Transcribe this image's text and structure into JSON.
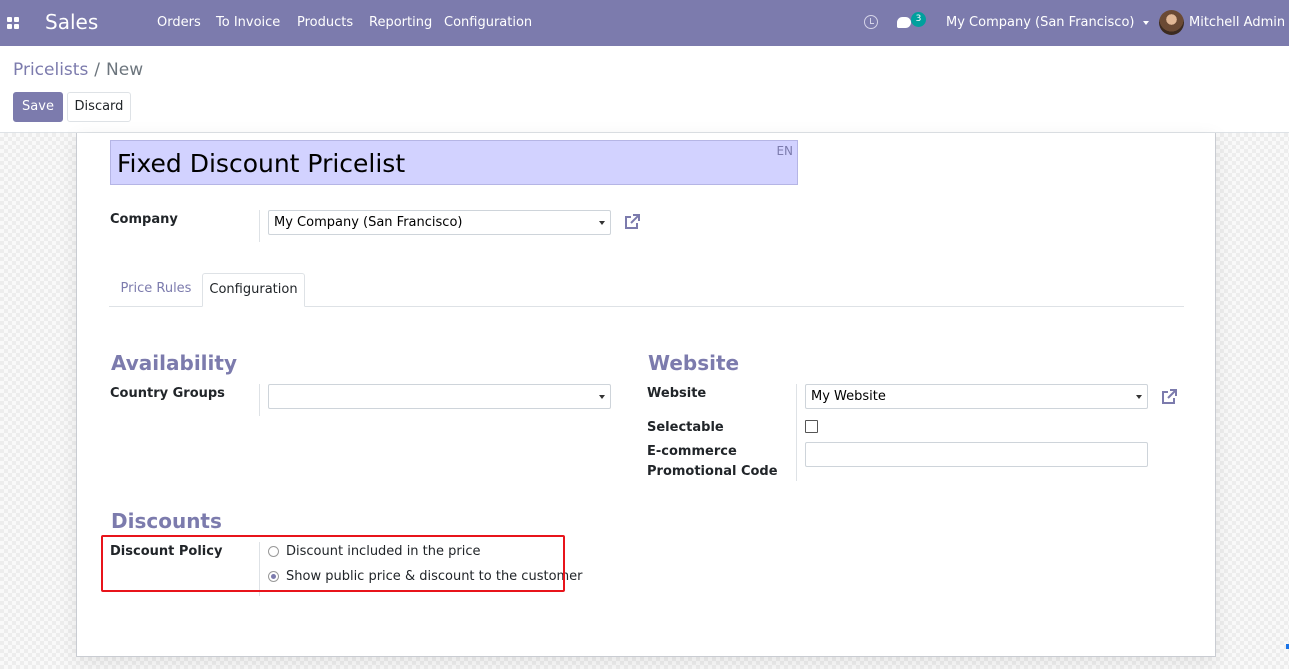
{
  "navbar": {
    "app_name": "Sales",
    "menu": [
      "Orders",
      "To Invoice",
      "Products",
      "Reporting",
      "Configuration"
    ],
    "chat_count": "3",
    "company": "My Company (San Francisco)",
    "user": "Mitchell Admin"
  },
  "breadcrumb": {
    "parent": "Pricelists",
    "separator": "/",
    "current": "New"
  },
  "buttons": {
    "save": "Save",
    "discard": "Discard"
  },
  "form": {
    "name": "Fixed Discount Pricelist",
    "lang": "EN",
    "company_label": "Company",
    "company_value": "My Company (San Francisco)",
    "tabs": [
      "Price Rules",
      "Configuration"
    ],
    "active_tab": "Configuration",
    "availability": {
      "title": "Availability",
      "country_groups_label": "Country Groups",
      "country_groups_value": ""
    },
    "website": {
      "title": "Website",
      "website_label": "Website",
      "website_value": "My Website",
      "selectable_label": "Selectable",
      "selectable_checked": false,
      "promo_label_line1": "E-commerce",
      "promo_label_line2": "Promotional Code",
      "promo_value": ""
    },
    "discounts": {
      "title": "Discounts",
      "policy_label": "Discount Policy",
      "options": [
        "Discount included in the price",
        "Show public price & discount to the customer"
      ],
      "selected_index": 1
    }
  },
  "colors": {
    "brand": "#7c7bad",
    "title_bg": "#d2d2ff",
    "highlight": "#e8141b",
    "badge": "#00a09d"
  }
}
